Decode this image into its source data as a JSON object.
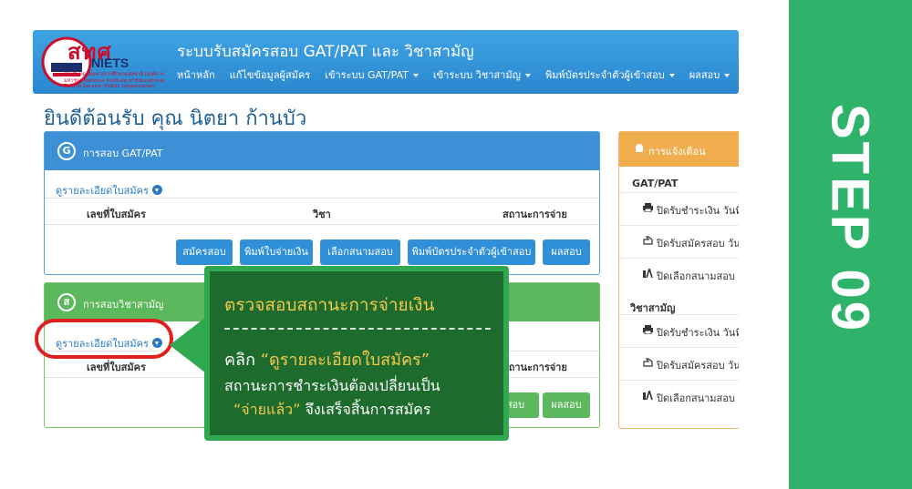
{
  "header": {
    "logo_text": "สทศ",
    "logo_sub": "NIETS",
    "logo_caption": "สถาบันทดสอบทางการศึกษาแห่งชาติ (องค์การมหาชน) National Institute of Educational Testing Service (Public Organization)",
    "title": "ระบบรับสมัครสอบ GAT/PAT และ วิชาสามัญ",
    "nav": [
      {
        "label": "หน้าหลัก",
        "dropdown": false
      },
      {
        "label": "แก้ไขข้อมูลผู้สมัคร",
        "dropdown": false
      },
      {
        "label": "เข้าระบบ GAT/PAT",
        "dropdown": true
      },
      {
        "label": "เข้าระบบ วิชาสามัญ",
        "dropdown": true
      },
      {
        "label": "พิมพ์บัตรประจำตัวผู้เข้าสอบ",
        "dropdown": true
      },
      {
        "label": "ผลสอบ",
        "dropdown": true
      }
    ]
  },
  "welcome": "ยินดีต้อนรับ คุณ นิตยา ก้านบัว",
  "gat": {
    "icon_letter": "G",
    "title": "การสอบ GAT/PAT",
    "detail_link": "ดูรายละเอียดใบสมัคร",
    "columns": [
      "เลขที่ใบสมัคร",
      "วิชา",
      "สถานะการจ่าย"
    ],
    "buttons": [
      "สมัครสอบ",
      "พิมพ์ใบจ่ายเงิน",
      "เลือกสนามสอบ",
      "พิมพ์บัตรประจำตัวผู้เข้าสอบ",
      "ผลสอบ"
    ]
  },
  "subject": {
    "icon_letter": "ส",
    "title": "การสอบวิชาสามัญ",
    "detail_link": "ดูรายละเอียดใบสมัคร",
    "columns": [
      "เลขที่ใบสมัคร",
      "สถานะการจ่าย"
    ],
    "buttons": [
      "สอบ",
      "ผลสอบ"
    ]
  },
  "notifications": {
    "title": "การแจ้งเตือน",
    "sections": [
      {
        "name": "GAT/PAT",
        "items": [
          "ปิดรับชำระเงิน วันที่ ",
          "ปิดรับสมัครสอบ วันที่",
          "ปิดเลือกสนามสอบ :"
        ]
      },
      {
        "name": "วิชาสามัญ",
        "items": [
          "ปิดรับชำระเงิน วันที่ :",
          "ปิดรับสมัครสอบ วันที่",
          "ปิดเลือกสนามสอบ :"
        ]
      }
    ]
  },
  "callout": {
    "title": "ตรวจสอบสถานะการจ่ายเงิน",
    "line1_prefix": "คลิก",
    "line1_quote": "“ดูรายละเอียดใบสมัคร”",
    "line2": "สถานะการชำระเงินต้องเปลี่ยนเป็น",
    "line3_quote": "“จ่ายแล้ว”",
    "line3_suffix": " จึงเสร็จสิ้นการสมัคร"
  },
  "step": {
    "label": "STEP 09"
  },
  "colors": {
    "header": "#2b86cf",
    "gat_panel": "#3d8fd6",
    "subject_panel": "#5cb85c",
    "notif_panel": "#f0ad4e",
    "step_bar": "#2fb36a",
    "callout_bg": "#1e6b2e",
    "highlight": "#e02020"
  }
}
